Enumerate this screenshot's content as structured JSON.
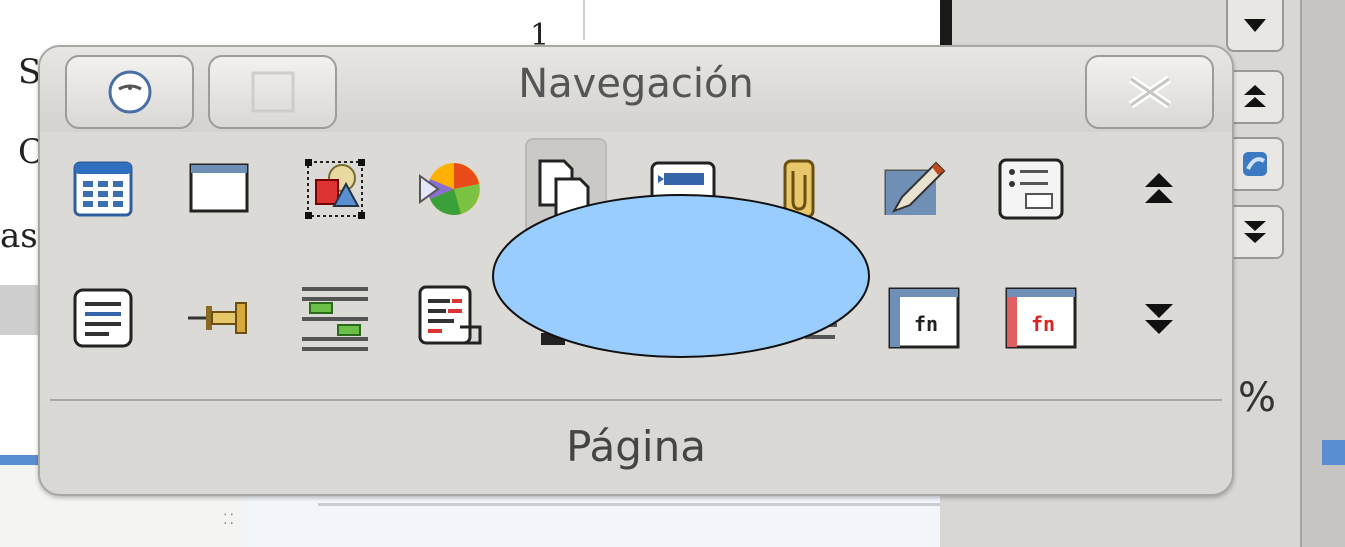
{
  "window": {
    "title": "Navegación",
    "status_text": "Página"
  },
  "background": {
    "fragments": [
      "S",
      "C",
      "as",
      "1"
    ],
    "zoom_suffix": "%"
  },
  "toolbar": {
    "row1": [
      {
        "name": "table-icon"
      },
      {
        "name": "frame-icon"
      },
      {
        "name": "drawing-objects-icon"
      },
      {
        "name": "ole-object-icon"
      },
      {
        "name": "copy-pages-icon",
        "active": true
      },
      {
        "name": "section-icon"
      },
      {
        "name": "paperclip-icon"
      },
      {
        "name": "edit-pencil-icon"
      },
      {
        "name": "list-box-icon"
      },
      {
        "name": "jump-up-icon"
      }
    ],
    "row2": [
      {
        "name": "paragraph-icon"
      },
      {
        "name": "bookmark-pin-icon"
      },
      {
        "name": "headings-icon"
      },
      {
        "name": "document-edit-icon"
      },
      {
        "name": "field-fn-icon"
      },
      {
        "name": "field-fn-red-icon"
      },
      {
        "name": "jump-down-icon"
      }
    ]
  },
  "colors": {
    "blob_fill": "#99ccff",
    "window_bg": "#dcdad6"
  }
}
